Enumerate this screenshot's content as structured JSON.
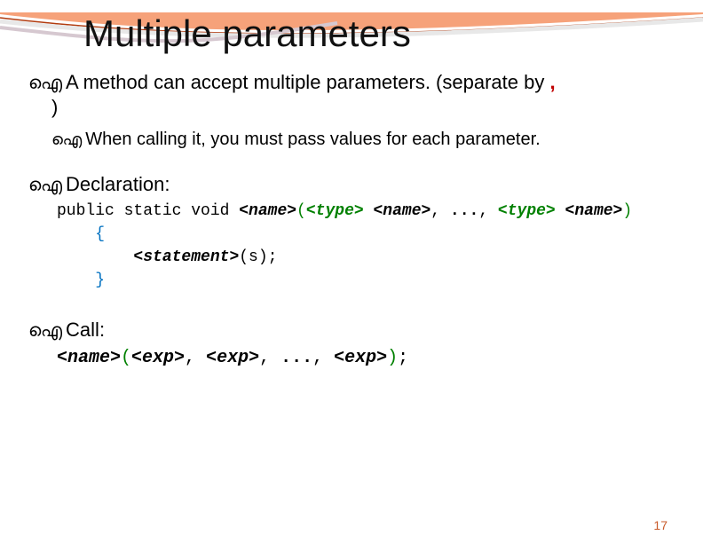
{
  "title": "Multiple parameters",
  "bullet_glyph": "ഐ",
  "line1_part1": "A method can accept multiple parameters. (separate by ",
  "line1_comma": ",",
  "line1_part2": ")",
  "line2": "When calling it, you must pass values for each parameter.",
  "decl_heading": "Declaration:",
  "decl": {
    "mods": "public static void ",
    "name": "<name>",
    "open": "(",
    "type": "<type>",
    "sp": " ",
    "sep": ", ",
    "dots": "...",
    "close": ")",
    "brace_open": "{",
    "stmt_indent": "        ",
    "stmt": "<statement>",
    "stmt_suffix": "(s)",
    "semi": ";",
    "brace_close": "}",
    "indent": "    "
  },
  "call_heading": "Call:",
  "call": {
    "name": "<name>",
    "open": "(",
    "exp": "<exp>",
    "sep": ", ",
    "dots": "...",
    "close": ")",
    "semi": ";"
  },
  "page_number": "17"
}
